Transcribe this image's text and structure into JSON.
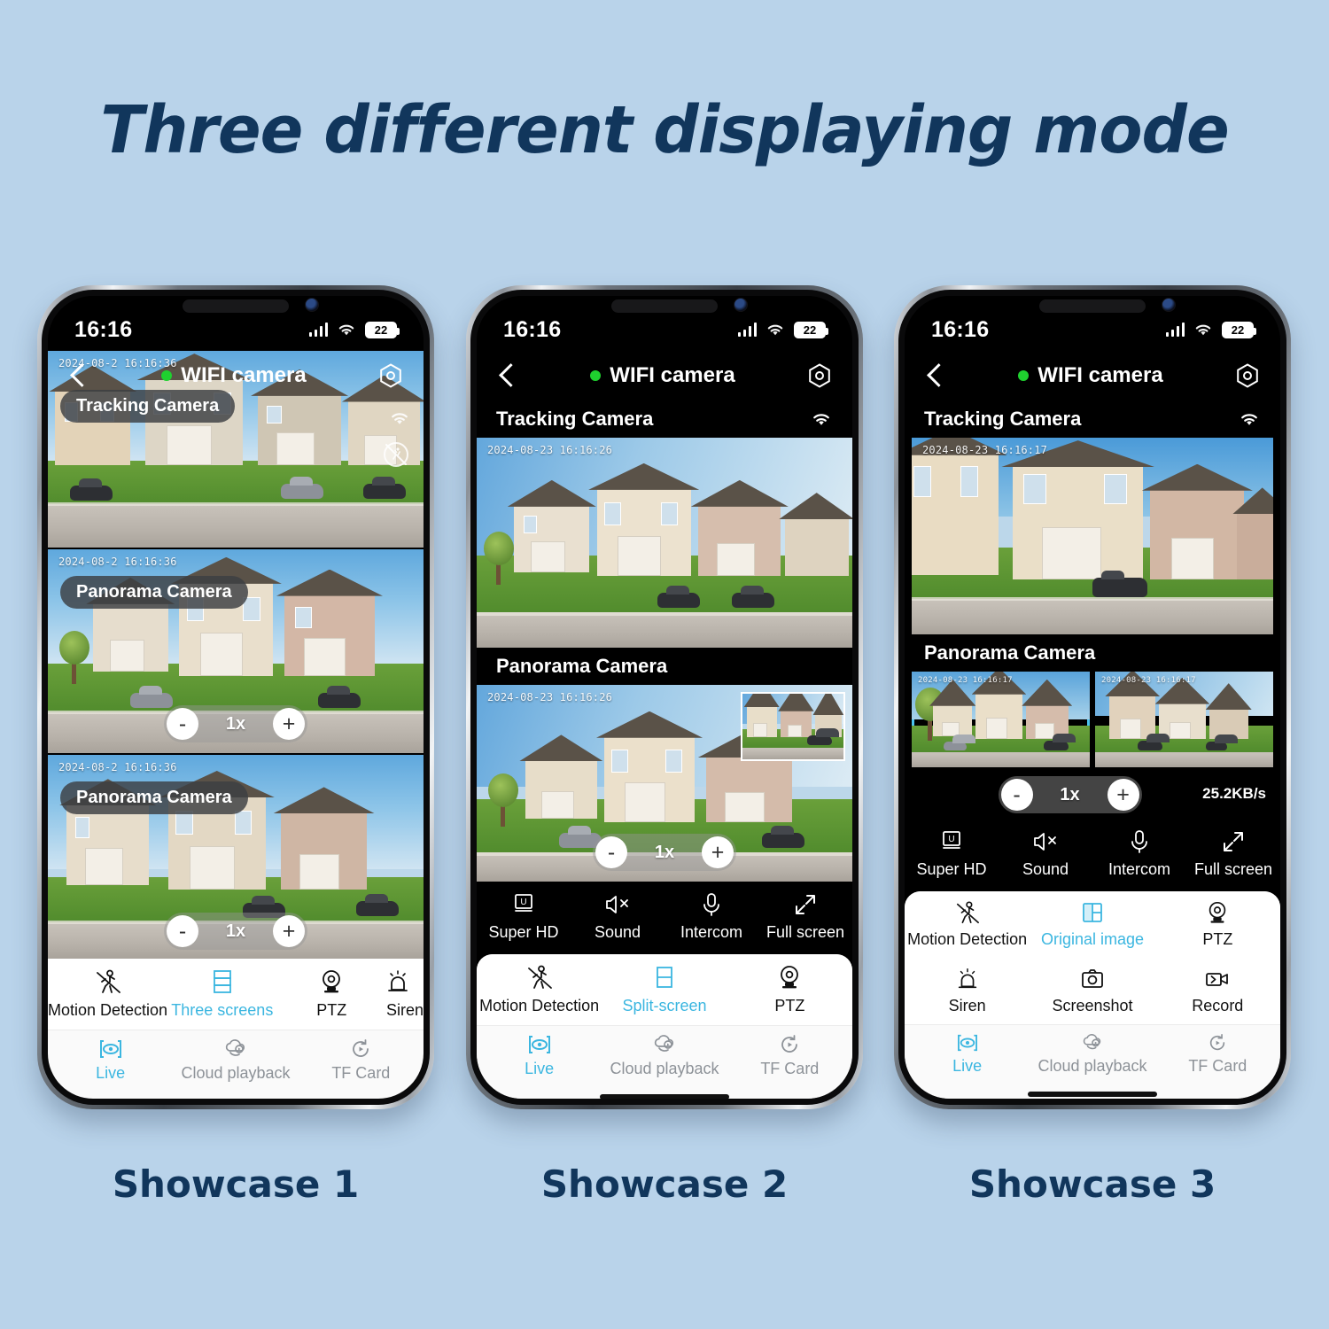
{
  "headline": "Three different displaying mode",
  "theme": {
    "background": "#b9d3ea",
    "heading_color": "#11365c",
    "accent": "#3bb6e0",
    "status_green": "#1fd12f"
  },
  "status_bar": {
    "time": "16:16",
    "battery": "22",
    "signal_icon": "cellular-bars-icon",
    "wifi_icon": "wifi-icon"
  },
  "app": {
    "title": "WIFI camera",
    "back_icon": "back-chevron-icon",
    "settings_icon": "gear-hex-icon",
    "online_indicator": "online-dot"
  },
  "labels": {
    "tracking_camera": "Tracking Camera",
    "panorama_camera": "Panorama Camera"
  },
  "phones": [
    {
      "caption": "Showcase 1",
      "mode": "three-screens",
      "panels": [
        {
          "label": "Tracking Camera",
          "timestamp": "2024-08-2  16:16:36"
        },
        {
          "label": "Panorama Camera",
          "timestamp": "2024-08-2  16:16:36",
          "zoom": "1x"
        },
        {
          "label": "Panorama Camera",
          "timestamp": "2024-08-2  16:16:36",
          "zoom": "1x"
        }
      ],
      "feature_row": [
        {
          "label": "Motion Detection",
          "icon": "motion-detection-off-icon",
          "active": false
        },
        {
          "label": "Three screens",
          "icon": "three-screens-icon",
          "active": true
        },
        {
          "label": "PTZ",
          "icon": "ptz-camera-icon",
          "active": false
        },
        {
          "label": "Siren",
          "icon": "siren-icon",
          "active": false
        }
      ],
      "tabs": [
        {
          "label": "Live",
          "icon": "live-eye-icon",
          "active": true
        },
        {
          "label": "Cloud playback",
          "icon": "cloud-playback-icon",
          "active": false
        },
        {
          "label": "TF Card",
          "icon": "tf-card-icon",
          "active": false
        }
      ]
    },
    {
      "caption": "Showcase 2",
      "mode": "split-screen",
      "panels": [
        {
          "label": "Tracking Camera",
          "timestamp": "2024-08-23  16:16:26"
        },
        {
          "label": "Panorama Camera",
          "timestamp": "2024-08-23  16:16:26",
          "zoom": "1x"
        }
      ],
      "control_row": [
        {
          "label": "Super HD",
          "icon": "super-hd-icon"
        },
        {
          "label": "Sound",
          "icon": "sound-muted-icon"
        },
        {
          "label": "Intercom",
          "icon": "microphone-icon"
        },
        {
          "label": "Full screen",
          "icon": "fullscreen-icon"
        }
      ],
      "feature_row": [
        {
          "label": "Motion Detection",
          "icon": "motion-detection-off-icon",
          "active": false
        },
        {
          "label": "Split-screen",
          "icon": "split-screen-icon",
          "active": true
        },
        {
          "label": "PTZ",
          "icon": "ptz-camera-icon",
          "active": false
        }
      ],
      "tabs": [
        {
          "label": "Live",
          "icon": "live-eye-icon",
          "active": true
        },
        {
          "label": "Cloud playback",
          "icon": "cloud-playback-icon",
          "active": false
        },
        {
          "label": "TF Card",
          "icon": "tf-card-icon",
          "active": false
        }
      ]
    },
    {
      "caption": "Showcase 3",
      "mode": "original-image",
      "panels": [
        {
          "label": "Tracking Camera",
          "timestamp": "2024-08-23  16:16:17"
        },
        {
          "label": "Panorama Camera",
          "timestamp_left": "2024-08-23  16:16:17",
          "timestamp_right": "2024-08-23  16:16:17"
        }
      ],
      "zoom": "1x",
      "bitrate": "25.2KB/s",
      "control_row": [
        {
          "label": "Super HD",
          "icon": "super-hd-icon"
        },
        {
          "label": "Sound",
          "icon": "sound-muted-icon"
        },
        {
          "label": "Intercom",
          "icon": "microphone-icon"
        },
        {
          "label": "Full screen",
          "icon": "fullscreen-icon"
        }
      ],
      "feature_grid": [
        {
          "label": "Motion Detection",
          "icon": "motion-detection-off-icon",
          "active": false
        },
        {
          "label": "Original image",
          "icon": "original-image-icon",
          "active": true
        },
        {
          "label": "PTZ",
          "icon": "ptz-camera-icon",
          "active": false
        },
        {
          "label": "Siren",
          "icon": "siren-icon",
          "active": false
        },
        {
          "label": "Screenshot",
          "icon": "screenshot-camera-icon",
          "active": false
        },
        {
          "label": "Record",
          "icon": "record-video-icon",
          "active": false
        }
      ],
      "tabs": [
        {
          "label": "Live",
          "icon": "live-eye-icon",
          "active": true
        },
        {
          "label": "Cloud playback",
          "icon": "cloud-playback-icon",
          "active": false
        },
        {
          "label": "TF Card",
          "icon": "tf-card-icon",
          "active": false
        }
      ]
    }
  ],
  "zoom_controls": {
    "minus": "-",
    "plus": "+"
  }
}
